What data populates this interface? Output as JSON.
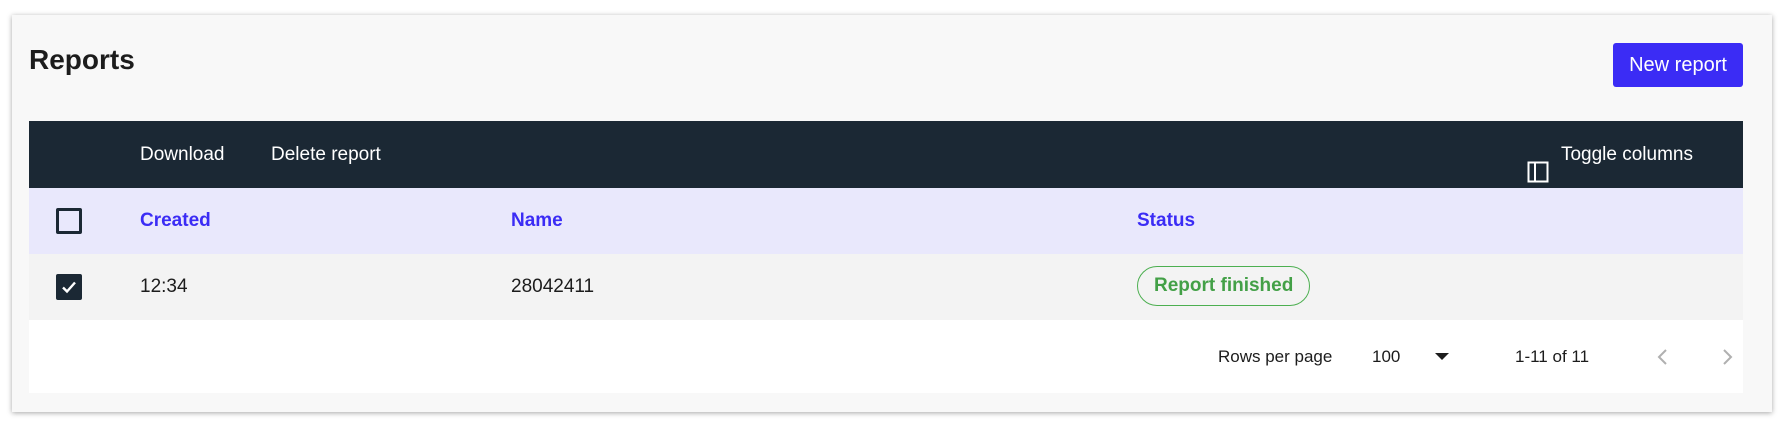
{
  "header": {
    "title": "Reports",
    "new_report_label": "New report"
  },
  "toolbar": {
    "download_label": "Download",
    "delete_label": "Delete report",
    "toggle_columns_label": "Toggle columns",
    "toggle_icon": "columns-icon"
  },
  "table": {
    "columns": [
      "Created",
      "Name",
      "Status"
    ],
    "rows": [
      {
        "selected": true,
        "created": "12:34",
        "name": "28042411",
        "status": "Report finished"
      }
    ]
  },
  "pagination": {
    "rows_per_page_label": "Rows per page",
    "rows_per_page_value": "100",
    "range_label": "1-11 of 11"
  },
  "colors": {
    "accent": "#3b2cf5",
    "toolbar_bg": "#1b2834",
    "header_bg": "#e9e8fc",
    "status_success": "#43a047"
  }
}
